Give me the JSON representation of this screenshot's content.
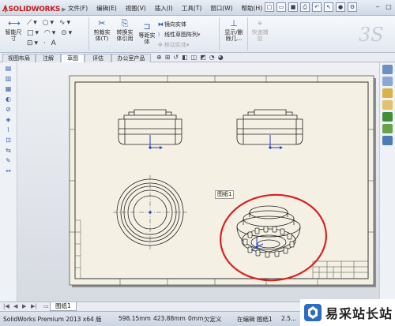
{
  "app": {
    "logo": "SOLIDWORKS"
  },
  "menu": [
    "文件(F)",
    "编辑(E)",
    "视图(V)",
    "插入(I)",
    "工具(T)",
    "窗口(W)",
    "帮助(H)"
  ],
  "ribbon": {
    "smart_dim_line1": "智能尺",
    "smart_dim_line2": "寸",
    "trim_line1": "剪裁实",
    "trim_line2": "体(T)",
    "convert_line1": "转换实",
    "convert_line2": "体引用",
    "offset_line1": "等距实",
    "offset_line2": "体",
    "mirror": "镜向实体",
    "linear_pattern": "线性草图阵列",
    "move": "移动实体",
    "show_hide_line1": "显示/删",
    "show_hide_line2": "除几...",
    "quick_snap_line1": "快速捕",
    "quick_snap_line2": "捉"
  },
  "tabs": [
    "视图布局",
    "注解",
    "草图",
    "评估",
    "办公室产品"
  ],
  "active_tab": "草图",
  "canvas": {
    "sheet_tooltip": "图纸1"
  },
  "sheet_tab": "图纸1",
  "status": {
    "product": "SolidWorks Premium 2013 x64 版",
    "x": "598.15mm",
    "y": "423.88mm",
    "z": "0mm",
    "state": "欠定义",
    "editing": "在编辑 图纸1",
    "scale": "2.5..."
  },
  "watermark": "易采站长站",
  "colors": {
    "highlight_circle": "#d92121",
    "sheet": "#f4f1e4",
    "accent": "#2a5ea8"
  }
}
